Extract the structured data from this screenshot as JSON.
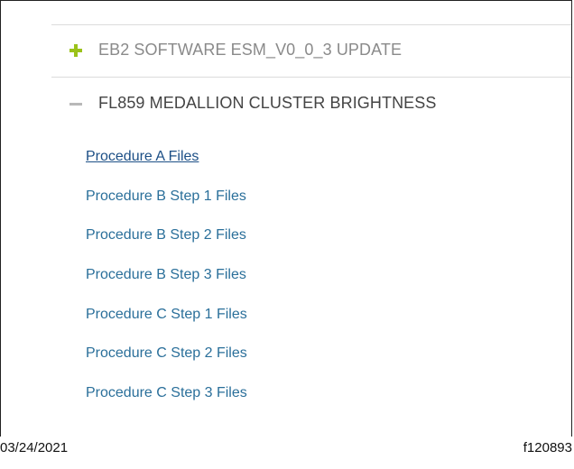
{
  "accordion": {
    "sections": [
      {
        "label": "EB2 SOFTWARE ESM_V0_0_3 UPDATE",
        "state": "collapsed",
        "icon": "plus-icon",
        "icon_color": "#9bc21a"
      },
      {
        "label": "FL859 MEDALLION CLUSTER BRIGHTNESS",
        "state": "expanded",
        "icon": "minus-icon",
        "icon_color": "#b8b8b8"
      }
    ]
  },
  "files": {
    "links": [
      {
        "label": "Procedure A Files",
        "active": true
      },
      {
        "label": "Procedure B Step 1 Files"
      },
      {
        "label": "Procedure B Step 2 Files"
      },
      {
        "label": "Procedure B Step 3 Files"
      },
      {
        "label": "Procedure C Step 1 Files"
      },
      {
        "label": "Procedure C Step 2 Files"
      },
      {
        "label": "Procedure C Step 3 Files"
      }
    ],
    "link_color": "#2a6f9a"
  },
  "footer": {
    "date": "03/24/2021",
    "figure_id": "f120893"
  }
}
